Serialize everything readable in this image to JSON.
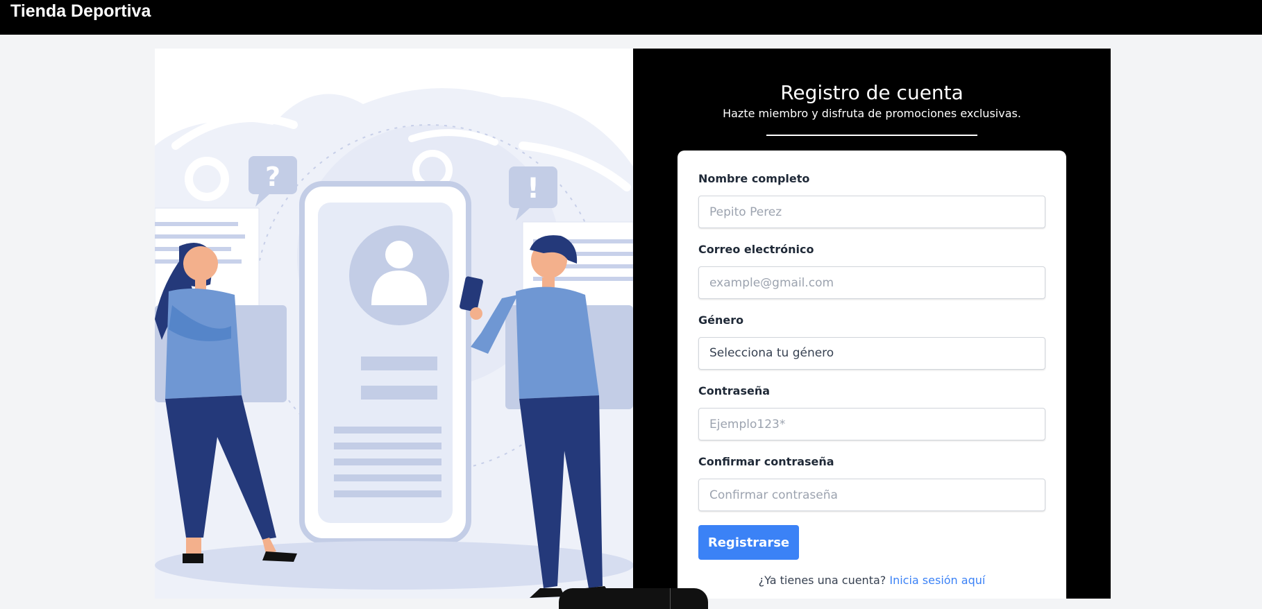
{
  "app": {
    "brand": "Tienda Deportiva"
  },
  "colors": {
    "accent": "#3b82f6",
    "header_bg": "#000000",
    "page_bg": "#f3f4f6"
  },
  "illustration": {
    "icon": "registration-illustration"
  },
  "form": {
    "title": "Registro de cuenta",
    "subtitle": "Hazte miembro y disfruta de promociones exclusivas.",
    "fields": {
      "name": {
        "label": "Nombre completo",
        "placeholder": "Pepito Perez",
        "value": ""
      },
      "email": {
        "label": "Correo electrónico",
        "placeholder": "example@gmail.com",
        "value": ""
      },
      "gender": {
        "label": "Género",
        "selected": "Selecciona tu género"
      },
      "password": {
        "label": "Contraseña",
        "placeholder": "Ejemplo123*",
        "value": ""
      },
      "confirm": {
        "label": "Confirmar contraseña",
        "placeholder": "Confirmar contraseña",
        "value": ""
      }
    },
    "submit_label": "Registrarse",
    "login_prompt": "¿Ya tienes una cuenta?",
    "login_link": "Inicia sesión aquí"
  }
}
